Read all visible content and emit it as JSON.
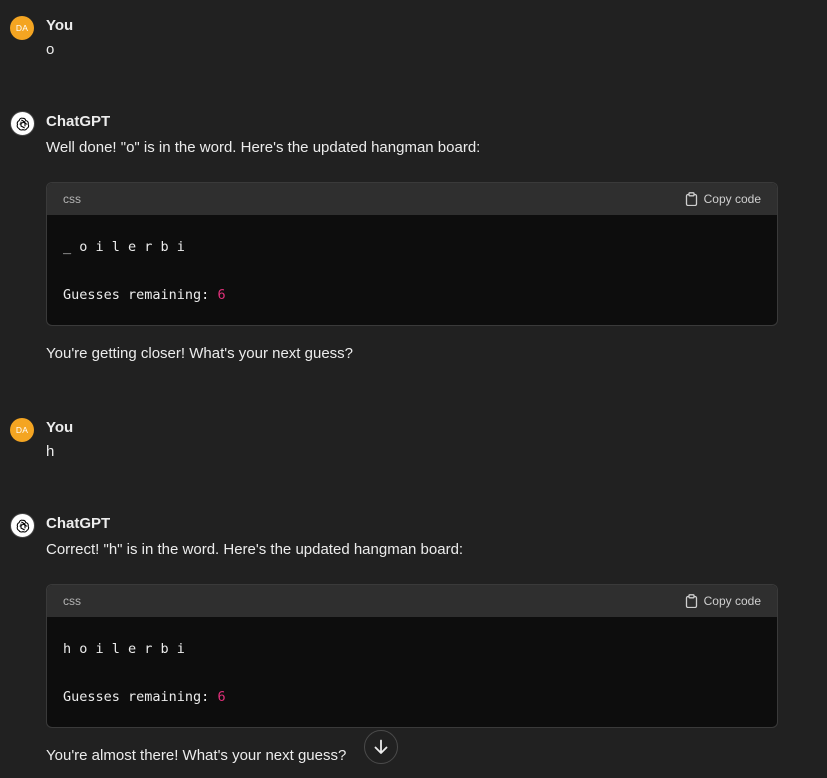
{
  "messages": [
    {
      "role": "user",
      "avatar_initials": "DA",
      "author": "You",
      "text": "o"
    },
    {
      "role": "assistant",
      "author": "ChatGPT",
      "intro": "Well done! \"o\" is in the word. Here's the updated hangman board:",
      "code": {
        "language": "css",
        "copy_label": "Copy code",
        "board": "_ o i l e r b i",
        "guesses_label": "Guesses remaining:",
        "guesses_value": "6"
      },
      "outro": "You're getting closer! What's your next guess?"
    },
    {
      "role": "user",
      "avatar_initials": "DA",
      "author": "You",
      "text": "h"
    },
    {
      "role": "assistant",
      "author": "ChatGPT",
      "intro": "Correct! \"h\" is in the word. Here's the updated hangman board:",
      "code": {
        "language": "css",
        "copy_label": "Copy code",
        "board": "h o i l e r b i",
        "guesses_label": "Guesses remaining:",
        "guesses_value": "6"
      },
      "outro": "You're almost there! What's your next guess?"
    }
  ],
  "colors": {
    "background": "#212121",
    "user_avatar": "#f4a522",
    "code_header": "#2f2f2f",
    "code_body": "#0d0d0d",
    "number_highlight": "#df3079"
  },
  "icons": {
    "assistant_avatar": "openai-logo-icon",
    "copy": "clipboard-icon",
    "scroll_down": "arrow-down-icon"
  }
}
